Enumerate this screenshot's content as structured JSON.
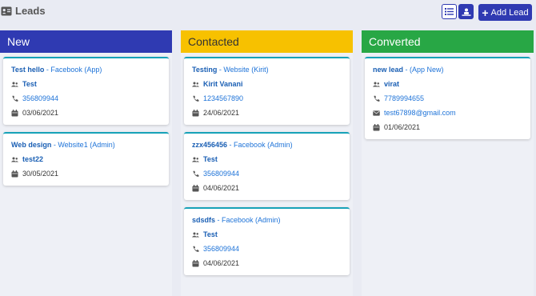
{
  "header": {
    "title": "Leads",
    "add_label": "Add Lead"
  },
  "colors": {
    "new": "#2f3ab2",
    "contacted": "#f7c100",
    "converted": "#28a745",
    "primary": "#2f3ab2"
  },
  "columns": [
    {
      "name": "New",
      "cards": [
        {
          "title": "Test hello",
          "source": " - Facebook (App)",
          "contact": "Test",
          "phone": "356809944",
          "date": "03/06/2021"
        },
        {
          "title": "Web design",
          "source": " - Website1 (Admin)",
          "contact": "test22",
          "date": "30/05/2021"
        }
      ]
    },
    {
      "name": "Contacted",
      "cards": [
        {
          "title": "Testing",
          "source": " - Website (Kirit)",
          "contact": "Kirit Vanani",
          "phone": "1234567890",
          "date": "24/06/2021"
        },
        {
          "title": "zzx456456",
          "source": " - Facebook (Admin)",
          "contact": "Test",
          "phone": "356809944",
          "date": "04/06/2021"
        },
        {
          "title": "sdsdfs",
          "source": " - Facebook (Admin)",
          "contact": "Test",
          "phone": "356809944",
          "date": "04/06/2021"
        }
      ]
    },
    {
      "name": "Converted",
      "cards": [
        {
          "title": "new lead",
          "source": " - (App New)",
          "contact": "virat",
          "phone": "7789994655",
          "email": "test67898@gmail.com",
          "date": "01/06/2021"
        }
      ]
    }
  ]
}
